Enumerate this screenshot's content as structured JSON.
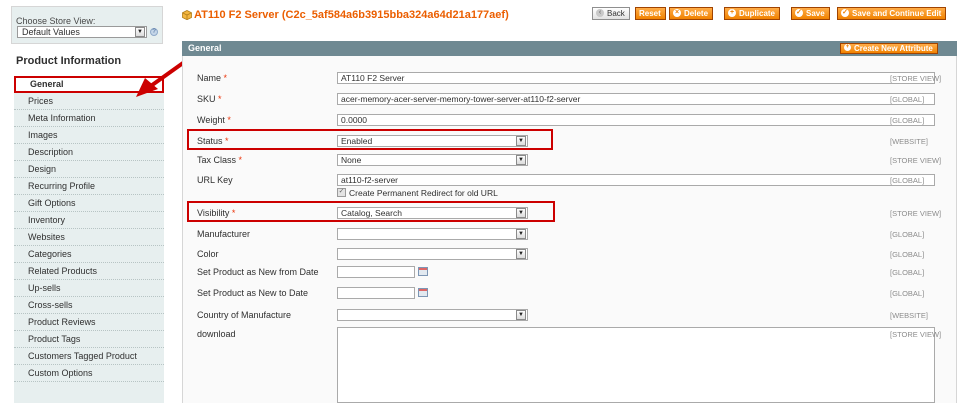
{
  "store": {
    "label": "Choose Store View:",
    "value": "Default Values",
    "help": "?"
  },
  "sidebar": {
    "title": "Product Information",
    "items": [
      {
        "label": "General"
      },
      {
        "label": "Prices"
      },
      {
        "label": "Meta Information"
      },
      {
        "label": "Images"
      },
      {
        "label": "Description"
      },
      {
        "label": "Design"
      },
      {
        "label": "Recurring Profile"
      },
      {
        "label": "Gift Options"
      },
      {
        "label": "Inventory"
      },
      {
        "label": "Websites"
      },
      {
        "label": "Categories"
      },
      {
        "label": "Related Products"
      },
      {
        "label": "Up-sells"
      },
      {
        "label": "Cross-sells"
      },
      {
        "label": "Product Reviews"
      },
      {
        "label": "Product Tags"
      },
      {
        "label": "Customers Tagged Product"
      },
      {
        "label": "Custom Options"
      }
    ]
  },
  "header": {
    "title": "AT110 F2 Server (C2c_5af584a6b3915bba324a64d21a177aef)",
    "buttons": {
      "back": "Back",
      "reset": "Reset",
      "delete": "Delete",
      "duplicate": "Duplicate",
      "save": "Save",
      "save_continue": "Save and Continue Edit"
    }
  },
  "section": {
    "title": "General",
    "create_attribute": "Create New Attribute"
  },
  "fields": {
    "name": {
      "label": "Name",
      "required": "*",
      "value": "AT110 F2 Server",
      "scope": "[STORE VIEW]"
    },
    "sku": {
      "label": "SKU",
      "required": "*",
      "value": "acer-memory-acer-server-memory-tower-server-at110-f2-server",
      "scope": "[GLOBAL]"
    },
    "weight": {
      "label": "Weight",
      "required": "*",
      "value": "0.0000",
      "scope": "[GLOBAL]"
    },
    "status": {
      "label": "Status",
      "required": "*",
      "value": "Enabled",
      "scope": "[WEBSITE]"
    },
    "tax_class": {
      "label": "Tax Class",
      "required": "*",
      "value": "None",
      "scope": "[STORE VIEW]"
    },
    "url_key": {
      "label": "URL Key",
      "value": "at110-f2-server",
      "redirect_label": "Create Permanent Redirect for old URL",
      "scope": "[GLOBAL]"
    },
    "visibility": {
      "label": "Visibility",
      "required": "*",
      "value": "Catalog, Search",
      "scope": "[STORE VIEW]"
    },
    "manufacturer": {
      "label": "Manufacturer",
      "value": "",
      "scope": "[GLOBAL]"
    },
    "color": {
      "label": "Color",
      "value": "",
      "scope": "[GLOBAL]"
    },
    "new_from": {
      "label": "Set Product as New from Date",
      "value": "",
      "scope": "[GLOBAL]"
    },
    "new_to": {
      "label": "Set Product as New to Date",
      "value": "",
      "scope": "[GLOBAL]"
    },
    "country": {
      "label": "Country of Manufacture",
      "value": "",
      "scope": "[WEBSITE]"
    },
    "download": {
      "label": "download",
      "value": "",
      "scope": "[STORE VIEW]"
    }
  },
  "colors": {
    "accent": "#eb5e00",
    "highlight": "#cc0000",
    "section_header": "#6f8992",
    "sidebar_bg": "#e7efef"
  }
}
